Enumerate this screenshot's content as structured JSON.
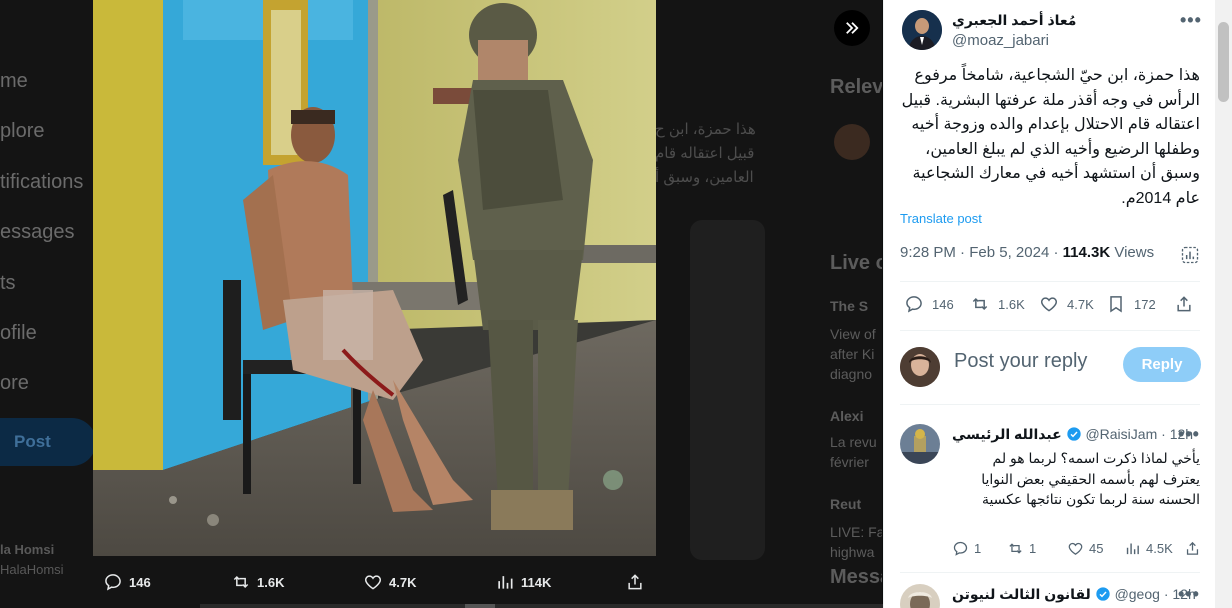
{
  "background": {
    "nav_items": [
      "me",
      "plore",
      "tifications",
      "essages",
      "ts",
      "ofile",
      "ore"
    ],
    "post_button": "Post",
    "user_name": "la Homsi",
    "user_handle": "HalaHomsi",
    "tweet_fragment_lines": [
      "هذا حمزة، ابن ح",
      "قبيل اعتقاله قام",
      "العامين، وسبق أ"
    ],
    "right_title": "Relev",
    "live_title": "Live o",
    "live_items": [
      "The S",
      "View of",
      "after Ki",
      "diagno",
      "Alexi",
      "La revu",
      "février",
      "Reut",
      "LIVE: Fa",
      "highwa"
    ],
    "messages_title": "Messa"
  },
  "media_bar": {
    "replies": "146",
    "reposts": "1.6K",
    "likes": "4.7K",
    "views": "114K"
  },
  "post": {
    "author_name": "مُعاذ أحمد الجعبري",
    "author_handle": "@moaz_jabari",
    "text": "هذا حمزة، ابن حيّ الشجاعية، شامخاً مرفوع الرأس في وجه أقذر ملة عرفتها البشرية. قبيل اعتقاله قام الاحتلال بإعدام والده وزوجة أخيه وطفلها الرضيع وأخيه الذي لم يبلغ العامين، وسبق أن استشهد أخيه  في معارك الشجاعية عام 2014م.",
    "translate_label": "Translate post",
    "time": "9:28 PM",
    "date": "Feb 5, 2024",
    "views_count": "114.3K",
    "views_label": "Views",
    "replies": "146",
    "reposts": "1.6K",
    "likes": "4.7K",
    "bookmarks": "172"
  },
  "compose": {
    "placeholder": "Post your reply",
    "button": "Reply"
  },
  "replies": [
    {
      "name": "عبدالله الرئيسي",
      "handle": "@RaisiJam",
      "time": "12h",
      "text": "يأخي لماذا ذكرت اسمه؟ لربما هو لم يعترف لهم بأسمه الحقيقي بعض النوايا الحسنه سنة لربما تكون نتائجها عكسية",
      "replies": "1",
      "reposts": "1",
      "likes": "45",
      "views": "4.5K"
    },
    {
      "name": "لقانون الثالث لنيوتن",
      "handle": "@geog",
      "time": "12h"
    }
  ],
  "colors": {
    "accent": "#1d9bf0",
    "reply_button": "#8ecdf8",
    "muted": "#536471"
  }
}
